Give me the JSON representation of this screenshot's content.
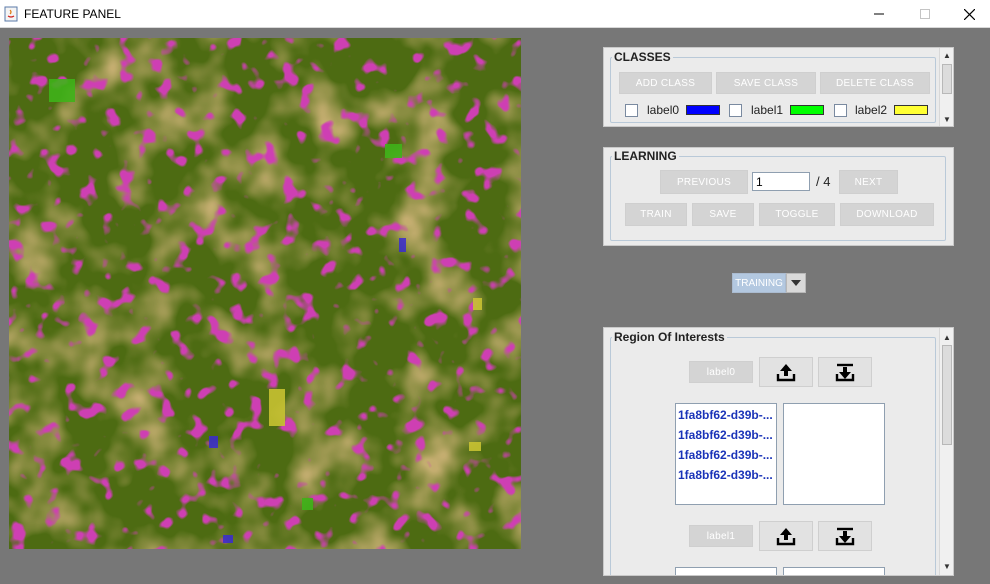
{
  "window": {
    "title": "FEATURE PANEL"
  },
  "classes": {
    "legend": "CLASSES",
    "add_label": "ADD CLASS",
    "save_label": "SAVE CLASS",
    "delete_label": "DELETE CLASS",
    "items": [
      {
        "label": "label0",
        "color": "#0000ff"
      },
      {
        "label": "label1",
        "color": "#00ff00"
      },
      {
        "label": "label2",
        "color": "#ffff33"
      }
    ]
  },
  "learning": {
    "legend": "LEARNING",
    "previous_label": "PREVIOUS",
    "page_value": "1",
    "page_total": "/ 4",
    "next_label": "NEXT",
    "train_label": "TRAIN",
    "save_label": "SAVE",
    "toggle_label": "TOGGLE",
    "download_label": "DOWNLOAD"
  },
  "mode_select": {
    "selected": "TRAINING"
  },
  "roi": {
    "legend": "Region Of Interests",
    "groups": [
      {
        "label": "label0",
        "items": [
          "1fa8bf62-d39b-...",
          "1fa8bf62-d39b-...",
          "1fa8bf62-d39b-...",
          "1fa8bf62-d39b-..."
        ]
      },
      {
        "label": "label1",
        "items": []
      }
    ]
  },
  "colors": {
    "roi_item_text": "#1a33b8",
    "button_bg": "#d4d4d4",
    "panel_bg": "#ebebeb"
  },
  "icons": {
    "upload": "upload-icon",
    "download": "download-icon",
    "dropdown": "chevron-down-icon"
  }
}
